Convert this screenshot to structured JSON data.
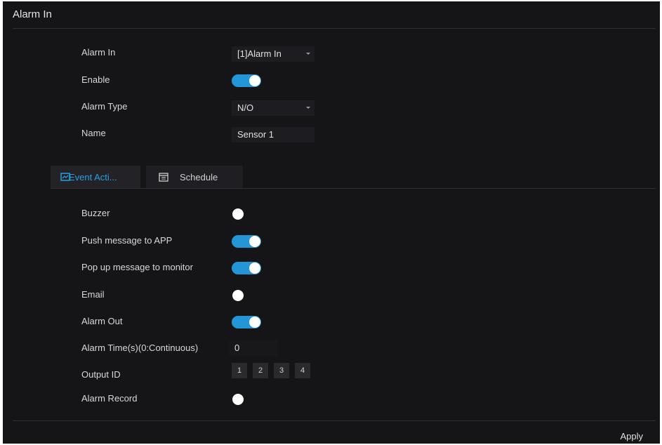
{
  "page": {
    "title": "Alarm In"
  },
  "settings": {
    "alarm_in": {
      "label": "Alarm In",
      "value": "[1]Alarm In"
    },
    "enable": {
      "label": "Enable",
      "on": true
    },
    "alarm_type": {
      "label": "Alarm Type",
      "value": "N/O"
    },
    "name": {
      "label": "Name",
      "value": "Sensor 1"
    }
  },
  "tabs": [
    {
      "label": "Event Acti...",
      "icon": "event-action-icon",
      "active": true
    },
    {
      "label": "Schedule",
      "icon": "calendar-icon",
      "active": false
    }
  ],
  "actions": {
    "buzzer": {
      "label": "Buzzer",
      "on": false
    },
    "push_app": {
      "label": "Push message to APP",
      "on": true
    },
    "popup_monitor": {
      "label": "Pop up message to monitor",
      "on": true
    },
    "email": {
      "label": "Email",
      "on": false
    },
    "alarm_out": {
      "label": "Alarm Out",
      "on": true
    },
    "alarm_time": {
      "label": "Alarm Time(s)(0:Continuous)",
      "value": "0"
    },
    "output_id": {
      "label": "Output ID",
      "options": [
        "1",
        "2",
        "3",
        "4"
      ]
    },
    "alarm_record": {
      "label": "Alarm Record",
      "on": false
    }
  },
  "footer": {
    "apply_label": "Apply"
  },
  "colors": {
    "accent": "#2496d8",
    "background": "#151517",
    "field": "#1d1d21"
  }
}
